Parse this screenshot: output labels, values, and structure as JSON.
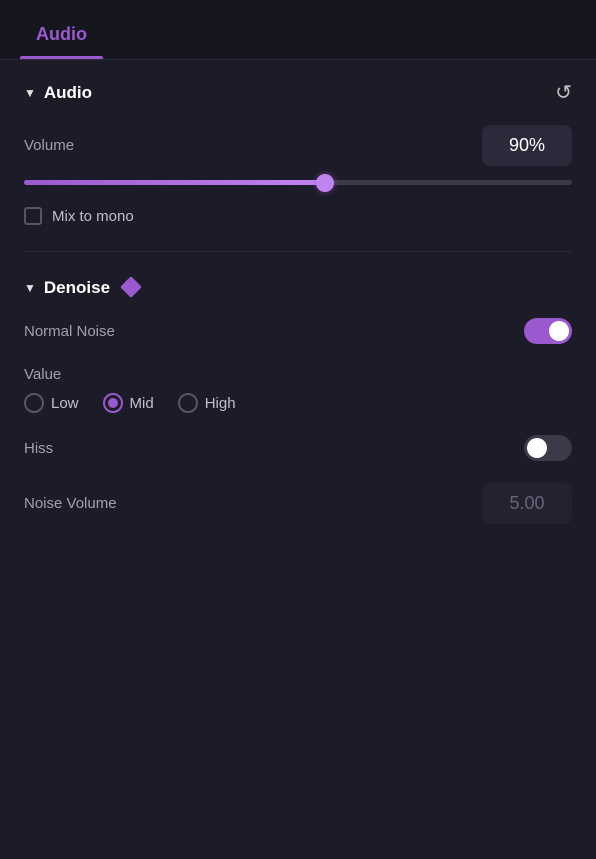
{
  "tab": {
    "label": "Audio"
  },
  "audio_section": {
    "title": "Audio",
    "volume_label": "Volume",
    "volume_value": "90%",
    "slider_fill_percent": 55,
    "mix_to_mono_label": "Mix to mono",
    "mix_to_mono_checked": false,
    "reset_icon": "↺"
  },
  "denoise_section": {
    "title": "Denoise",
    "normal_noise_label": "Normal Noise",
    "normal_noise_on": true,
    "value_label": "Value",
    "radio_options": [
      {
        "label": "Low",
        "selected": false
      },
      {
        "label": "Mid",
        "selected": true
      },
      {
        "label": "High",
        "selected": false
      }
    ],
    "hiss_label": "Hiss",
    "hiss_on": false,
    "noise_volume_label": "Noise Volume",
    "noise_volume_value": "5.00"
  }
}
